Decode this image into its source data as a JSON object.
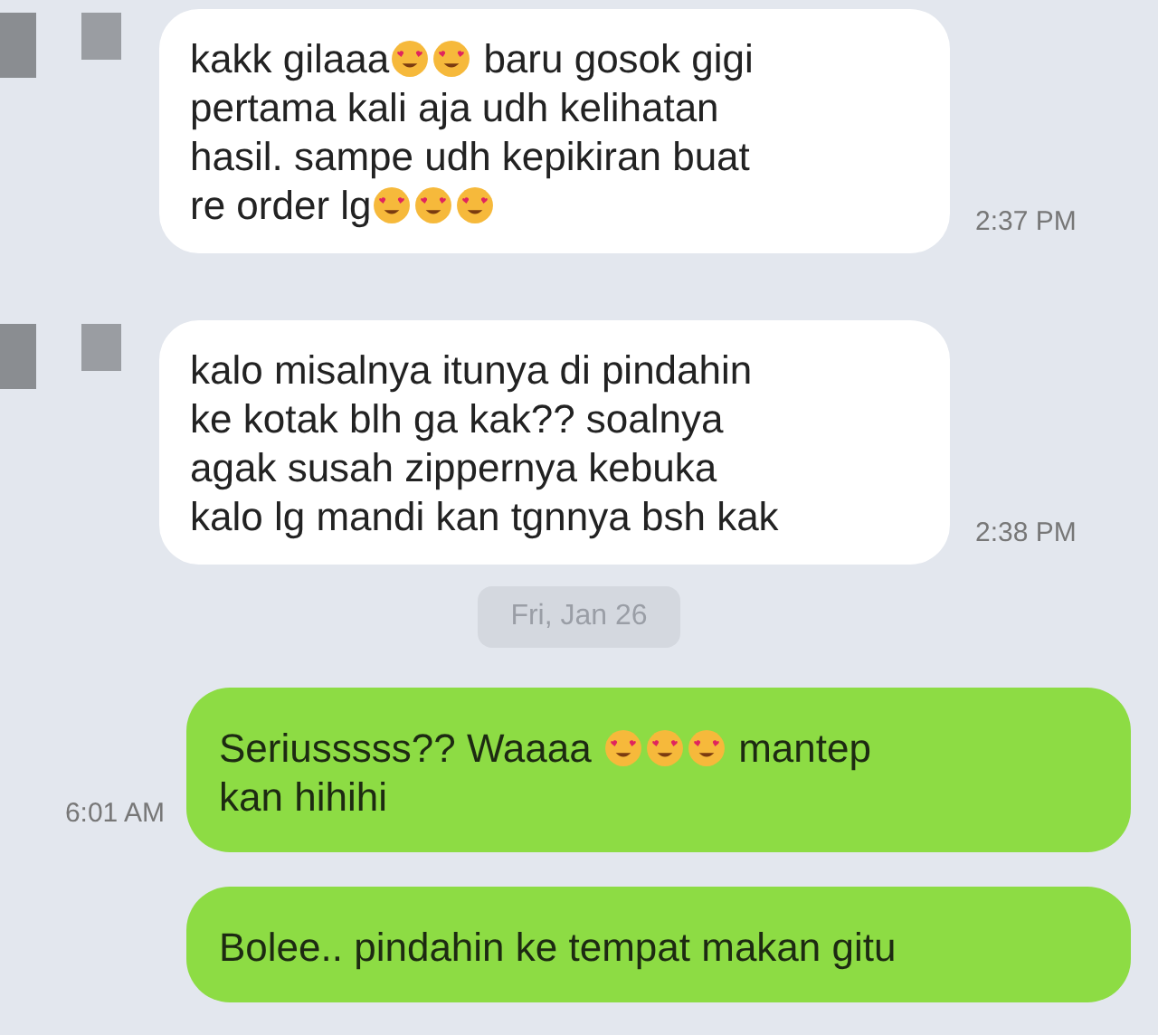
{
  "messages": [
    {
      "kind": "incoming",
      "time": "2:37 PM",
      "lines": [
        [
          {
            "kind": "text",
            "text": "kakk gilaaa"
          },
          {
            "kind": "emoji"
          },
          {
            "kind": "emoji"
          },
          {
            "kind": "text",
            "text": " baru gosok gigi"
          }
        ],
        [
          {
            "kind": "text",
            "text": "pertama kali aja udh kelihatan"
          }
        ],
        [
          {
            "kind": "text",
            "text": "hasil. sampe udh kepikiran buat"
          }
        ],
        [
          {
            "kind": "text",
            "text": "re order lg"
          },
          {
            "kind": "emoji"
          },
          {
            "kind": "emoji"
          },
          {
            "kind": "emoji"
          }
        ]
      ]
    },
    {
      "kind": "incoming",
      "time": "2:38 PM",
      "lines": [
        [
          {
            "kind": "text",
            "text": "kalo misalnya itunya di pindahin"
          }
        ],
        [
          {
            "kind": "text",
            "text": "ke kotak blh ga kak?? soalnya"
          }
        ],
        [
          {
            "kind": "text",
            "text": "agak susah zippernya kebuka"
          }
        ],
        [
          {
            "kind": "text",
            "text": "kalo lg mandi kan tgnnya bsh kak"
          }
        ]
      ]
    },
    {
      "kind": "date",
      "text": "Fri, Jan 26"
    },
    {
      "kind": "outgoing",
      "time": "6:01 AM",
      "lines": [
        [
          {
            "kind": "text",
            "text": "Seriusssss?? Waaaa "
          },
          {
            "kind": "emoji"
          },
          {
            "kind": "emoji"
          },
          {
            "kind": "emoji"
          },
          {
            "kind": "text",
            "text": " mantep"
          }
        ],
        [
          {
            "kind": "text",
            "text": "kan hihihi"
          }
        ]
      ]
    },
    {
      "kind": "outgoing",
      "lines": [
        [
          {
            "kind": "text",
            "text": "Bolee.. pindahin ke tempat makan gitu"
          }
        ]
      ]
    }
  ]
}
